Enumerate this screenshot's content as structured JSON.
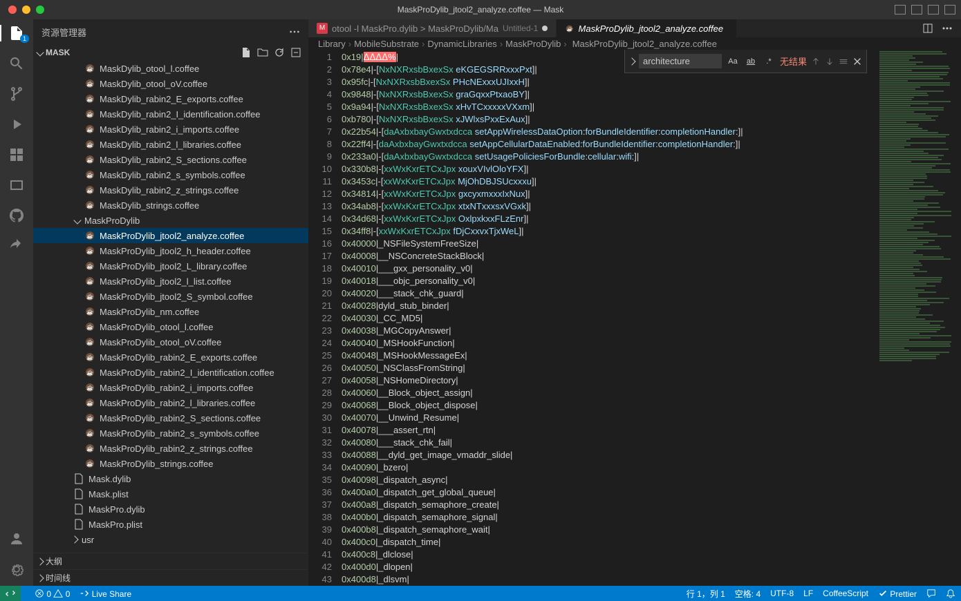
{
  "window_title": "MaskProDylib_jtool2_analyze.coffee — Mask",
  "sidebar_title": "资源管理器",
  "project_name": "MASK",
  "tree": [
    {
      "name": "MaskDylib_otool_l.coffee",
      "type": "coffee",
      "indent": 1
    },
    {
      "name": "MaskDylib_otool_oV.coffee",
      "type": "coffee",
      "indent": 1
    },
    {
      "name": "MaskDylib_rabin2_E_exports.coffee",
      "type": "coffee",
      "indent": 1
    },
    {
      "name": "MaskDylib_rabin2_I_identification.coffee",
      "type": "coffee",
      "indent": 1
    },
    {
      "name": "MaskDylib_rabin2_i_imports.coffee",
      "type": "coffee",
      "indent": 1
    },
    {
      "name": "MaskDylib_rabin2_l_libraries.coffee",
      "type": "coffee",
      "indent": 1
    },
    {
      "name": "MaskDylib_rabin2_S_sections.coffee",
      "type": "coffee",
      "indent": 1
    },
    {
      "name": "MaskDylib_rabin2_s_symbols.coffee",
      "type": "coffee",
      "indent": 1
    },
    {
      "name": "MaskDylib_rabin2_z_strings.coffee",
      "type": "coffee",
      "indent": 1
    },
    {
      "name": "MaskDylib_strings.coffee",
      "type": "coffee",
      "indent": 1
    },
    {
      "name": "MaskProDylib",
      "type": "folder",
      "indent": 0,
      "expanded": true
    },
    {
      "name": "MaskProDylib_jtool2_analyze.coffee",
      "type": "coffee",
      "indent": 1,
      "selected": true
    },
    {
      "name": "MaskProDylib_jtool2_h_header.coffee",
      "type": "coffee",
      "indent": 1
    },
    {
      "name": "MaskProDylib_jtool2_L_library.coffee",
      "type": "coffee",
      "indent": 1
    },
    {
      "name": "MaskProDylib_jtool2_l_list.coffee",
      "type": "coffee",
      "indent": 1
    },
    {
      "name": "MaskProDylib_jtool2_S_symbol.coffee",
      "type": "coffee",
      "indent": 1
    },
    {
      "name": "MaskProDylib_nm.coffee",
      "type": "coffee",
      "indent": 1
    },
    {
      "name": "MaskProDylib_otool_l.coffee",
      "type": "coffee",
      "indent": 1
    },
    {
      "name": "MaskProDylib_otool_oV.coffee",
      "type": "coffee",
      "indent": 1
    },
    {
      "name": "MaskProDylib_rabin2_E_exports.coffee",
      "type": "coffee",
      "indent": 1
    },
    {
      "name": "MaskProDylib_rabin2_I_identification.coffee",
      "type": "coffee",
      "indent": 1
    },
    {
      "name": "MaskProDylib_rabin2_i_imports.coffee",
      "type": "coffee",
      "indent": 1
    },
    {
      "name": "MaskProDylib_rabin2_l_libraries.coffee",
      "type": "coffee",
      "indent": 1
    },
    {
      "name": "MaskProDylib_rabin2_S_sections.coffee",
      "type": "coffee",
      "indent": 1
    },
    {
      "name": "MaskProDylib_rabin2_s_symbols.coffee",
      "type": "coffee",
      "indent": 1
    },
    {
      "name": "MaskProDylib_rabin2_z_strings.coffee",
      "type": "coffee",
      "indent": 1
    },
    {
      "name": "MaskProDylib_strings.coffee",
      "type": "coffee",
      "indent": 1
    },
    {
      "name": "Mask.dylib",
      "type": "file",
      "indent": "f"
    },
    {
      "name": "Mask.plist",
      "type": "file",
      "indent": "f"
    },
    {
      "name": "MaskPro.dylib",
      "type": "file",
      "indent": "f"
    },
    {
      "name": "MaskPro.plist",
      "type": "file",
      "indent": "f"
    },
    {
      "name": "usr",
      "type": "folder",
      "indent": "u",
      "expanded": false
    }
  ],
  "outline_label": "大纲",
  "timeline_label": "时间线",
  "tabs": [
    {
      "label": "otool -l MaskPro.dylib > MaskProDylib/Ma",
      "hint": "Untitled-1",
      "dirty": true,
      "active": false,
      "icon": "M"
    },
    {
      "label": "MaskProDylib_jtool2_analyze.coffee",
      "active": true,
      "icon": "coffee"
    }
  ],
  "breadcrumbs": [
    "Library",
    "MobileSubstrate",
    "DynamicLibraries",
    "MaskProDylib",
    "MaskProDylib_jtool2_analyze.coffee"
  ],
  "find": {
    "value": "architecture",
    "result": "无结果"
  },
  "code_lines": [
    {
      "n": 1,
      "addr": "0x19",
      "rest": "|",
      "cursor": "ᐃᐃᐃᐃ%"
    },
    {
      "n": 2,
      "addr": "0x78e4",
      "rest": "|-[",
      "cls": "NxNXRxsbBxexSx",
      "sel": " eKGEGSRRxxxPxt",
      "end": "]|"
    },
    {
      "n": 3,
      "addr": "0x95fc",
      "rest": "|-[",
      "cls": "NxNXRxsbBxexSx",
      "sel": " PHcNExxxUJIxxH",
      "end": "]|"
    },
    {
      "n": 4,
      "addr": "0x9848",
      "rest": "|-[",
      "cls": "NxNXRxsbBxexSx",
      "sel": " graGqxxPtxaoBY",
      "end": "]|"
    },
    {
      "n": 5,
      "addr": "0x9a94",
      "rest": "|-[",
      "cls": "NxNXRxsbBxexSx",
      "sel": " xHvTCxxxxxVXxm",
      "end": "]|"
    },
    {
      "n": 6,
      "addr": "0xb780",
      "rest": "|-[",
      "cls": "NxNXRxsbBxexSx",
      "sel": " xJWlxsPxxExAux",
      "end": "]|"
    },
    {
      "n": 7,
      "addr": "0x22b54",
      "rest": "|-[",
      "cls": "daAxbxbayGwxtxdcca",
      "msg": " setAppWirelessDataOption:forBundleIdentifier:completionHandler:",
      "end": "]|"
    },
    {
      "n": 8,
      "addr": "0x22ff4",
      "rest": "|-[",
      "cls": "daAxbxbayGwxtxdcca",
      "msg": " setAppCellularDataEnabled:forBundleIdentifier:completionHandler:",
      "end": "]|"
    },
    {
      "n": 9,
      "addr": "0x233a0",
      "rest": "|-[",
      "cls": "daAxbxbayGwxtxdcca",
      "msg": " setUsagePoliciesForBundle:cellular:wifi:",
      "end": "]|"
    },
    {
      "n": 10,
      "addr": "0x330b8",
      "rest": "|-[",
      "cls": "xxWxKxrETCxJpx",
      "sel": " xouxVIvlOloYFX",
      "end": "]|"
    },
    {
      "n": 11,
      "addr": "0x3453c",
      "rest": "|-[",
      "cls": "xxWxKxrETCxJpx",
      "sel": " MjOhDBJSUcxxxu",
      "end": "]|"
    },
    {
      "n": 12,
      "addr": "0x34814",
      "rest": "|-[",
      "cls": "xxWxKxrETCxJpx",
      "sel": " gxcyxmxxxIxNux",
      "end": "]|"
    },
    {
      "n": 13,
      "addr": "0x34ab8",
      "rest": "|-[",
      "cls": "xxWxKxrETCxJpx",
      "sel": " xtxNTxxxsxVGxk",
      "end": "]|"
    },
    {
      "n": 14,
      "addr": "0x34d68",
      "rest": "|-[",
      "cls": "xxWxKxrETCxJpx",
      "sel": " OxlpxkxxFLzEnr",
      "end": "]|"
    },
    {
      "n": 15,
      "addr": "0x34ff8",
      "rest": "|-[",
      "cls": "xxWxKxrETCxJpx",
      "sel": " fDjCxxvxTjxWeL",
      "end": "]|"
    },
    {
      "n": 16,
      "addr": "0x40000",
      "sym": "|_NSFileSystemFreeSize|"
    },
    {
      "n": 17,
      "addr": "0x40008",
      "sym": "|__NSConcreteStackBlock|"
    },
    {
      "n": 18,
      "addr": "0x40010",
      "sym": "|___gxx_personality_v0|"
    },
    {
      "n": 19,
      "addr": "0x40018",
      "sym": "|___objc_personality_v0|"
    },
    {
      "n": 20,
      "addr": "0x40020",
      "sym": "|___stack_chk_guard|"
    },
    {
      "n": 21,
      "addr": "0x40028",
      "sym": "|dyld_stub_binder|"
    },
    {
      "n": 22,
      "addr": "0x40030",
      "sym": "|_CC_MD5|"
    },
    {
      "n": 23,
      "addr": "0x40038",
      "sym": "|_MGCopyAnswer|"
    },
    {
      "n": 24,
      "addr": "0x40040",
      "sym": "|_MSHookFunction|"
    },
    {
      "n": 25,
      "addr": "0x40048",
      "sym": "|_MSHookMessageEx|"
    },
    {
      "n": 26,
      "addr": "0x40050",
      "sym": "|_NSClassFromString|"
    },
    {
      "n": 27,
      "addr": "0x40058",
      "sym": "|_NSHomeDirectory|"
    },
    {
      "n": 28,
      "addr": "0x40060",
      "sym": "|__Block_object_assign|"
    },
    {
      "n": 29,
      "addr": "0x40068",
      "sym": "|__Block_object_dispose|"
    },
    {
      "n": 30,
      "addr": "0x40070",
      "sym": "|__Unwind_Resume|"
    },
    {
      "n": 31,
      "addr": "0x40078",
      "sym": "|___assert_rtn|"
    },
    {
      "n": 32,
      "addr": "0x40080",
      "sym": "|___stack_chk_fail|"
    },
    {
      "n": 33,
      "addr": "0x40088",
      "sym": "|__dyld_get_image_vmaddr_slide|"
    },
    {
      "n": 34,
      "addr": "0x40090",
      "sym": "|_bzero|"
    },
    {
      "n": 35,
      "addr": "0x40098",
      "sym": "|_dispatch_async|"
    },
    {
      "n": 36,
      "addr": "0x400a0",
      "sym": "|_dispatch_get_global_queue|"
    },
    {
      "n": 37,
      "addr": "0x400a8",
      "sym": "|_dispatch_semaphore_create|"
    },
    {
      "n": 38,
      "addr": "0x400b0",
      "sym": "|_dispatch_semaphore_signal|"
    },
    {
      "n": 39,
      "addr": "0x400b8",
      "sym": "|_dispatch_semaphore_wait|"
    },
    {
      "n": 40,
      "addr": "0x400c0",
      "sym": "|_dispatch_time|"
    },
    {
      "n": 41,
      "addr": "0x400c8",
      "sym": "|_dlclose|"
    },
    {
      "n": 42,
      "addr": "0x400d0",
      "sym": "|_dlopen|"
    },
    {
      "n": 43,
      "addr": "0x400d8",
      "sym": "|_dlsvm|"
    }
  ],
  "status": {
    "errors": "0",
    "warnings": "0",
    "liveshare": "Live Share",
    "cursor": "行 1，列 1",
    "spaces": "空格: 4",
    "encoding": "UTF-8",
    "eol": "LF",
    "lang": "CoffeeScript",
    "prettier": "Prettier"
  },
  "explorer_badge": "1"
}
